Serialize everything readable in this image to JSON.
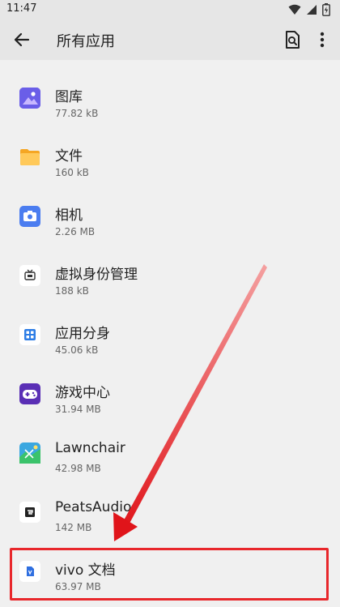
{
  "status_bar": {
    "time": "11:47"
  },
  "header": {
    "title": "所有应用"
  },
  "apps": [
    {
      "name": "图库",
      "size": "77.82 kB",
      "icon": "gallery-icon",
      "color": "#5b5fdc"
    },
    {
      "name": "文件",
      "size": "160 kB",
      "icon": "folder-icon",
      "color": "#f5a623"
    },
    {
      "name": "相机",
      "size": "2.26 MB",
      "icon": "camera-icon",
      "color": "#4b7df0"
    },
    {
      "name": "虚拟身份管理",
      "size": "188 kB",
      "icon": "tv-icon",
      "color": "#ffffff"
    },
    {
      "name": "应用分身",
      "size": "45.06 kB",
      "icon": "dual-app-icon",
      "color": "#2d7de6"
    },
    {
      "name": "游戏中心",
      "size": "31.94 MB",
      "icon": "gamepad-icon",
      "color": "#5a2fb5"
    },
    {
      "name": "Lawnchair",
      "size": "42.98 MB",
      "icon": "lawnchair-icon",
      "color": "#3aa7e0"
    },
    {
      "name": "PeatsAudio",
      "size": "142 MB",
      "icon": "peats-audio-icon",
      "color": "#ffffff"
    },
    {
      "name": "vivo 文档",
      "size": "63.97 MB",
      "icon": "vivo-doc-icon",
      "color": "#ffffff"
    }
  ]
}
